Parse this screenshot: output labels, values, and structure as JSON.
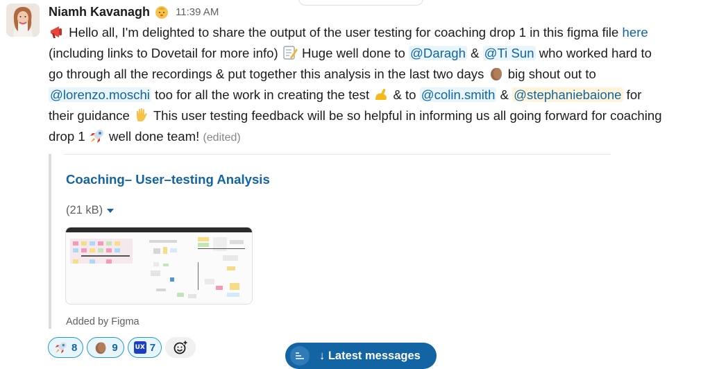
{
  "message": {
    "author": "Niamh Kavanagh",
    "timestamp": "11:39 AM",
    "status_icon": "baby-face-icon",
    "text": {
      "l1_a": "Hello all, I'm delighted to share the output of the user testing for coaching drop 1 in this figma file ",
      "l1_link": "here",
      "l2_a": "(including links to Dovetail for more info) ",
      "l2_b": " Huge well done to ",
      "mention_daragh": "@Daragh",
      "l2_c": " & ",
      "mention_tisun": "@Ti Sun",
      "l2_d": " who worked hard to",
      "l3_a": "go through all the recordings & put together this analysis in the last two days ",
      "l3_b": " big shout out to",
      "mention_lorenzo": "@lorenzo.moschi",
      "l4_a": " too for all the work in creating the test ",
      "l4_b": " & to ",
      "mention_colin": "@colin.smith",
      "l4_c": " & ",
      "mention_stephanie": "@stephaniebaione",
      "l4_d": " for",
      "l5_a": "their guidance ",
      "l5_b": "  This user testing feedback will be so helpful in informing us all going forward for coaching",
      "l6_a": "drop 1 ",
      "l6_b": " well done team! ",
      "edited": "(edited)"
    }
  },
  "attachment": {
    "title": "Coaching– User–testing Analysis",
    "size": "(21 kB)",
    "footer": "Added by Figma"
  },
  "reactions": [
    {
      "icon": "rocket-icon",
      "count": "8"
    },
    {
      "icon": "clap-icon",
      "count": "9"
    },
    {
      "icon": "ux-icon",
      "label": "UX",
      "count": "7"
    }
  ],
  "latest_messages": {
    "label": "↓ Latest messages"
  },
  "colors": {
    "link": "#1264a3",
    "mention_bg": "#e8f5fa",
    "self_mention_bg": "#fef4d9",
    "button": "#1264a3"
  }
}
